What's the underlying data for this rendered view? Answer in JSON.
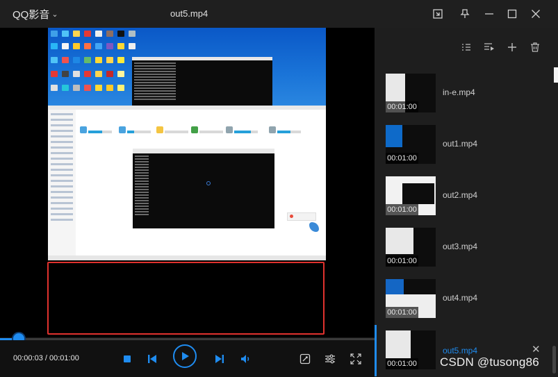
{
  "app": {
    "name": "QQ影音",
    "menu_icon": "chevron-down-icon"
  },
  "window": {
    "title": "out5.mp4",
    "controls": [
      "mini-mode-icon",
      "pin-icon",
      "minimize-icon",
      "maximize-icon",
      "close-icon"
    ]
  },
  "player": {
    "time_current": "00:00:03",
    "time_total": "00:01:00",
    "time_display": "00:00:03 / 00:01:00",
    "progress_fraction": 0.05,
    "controls": [
      "stop-icon",
      "previous-icon",
      "play-icon",
      "next-icon",
      "volume-icon"
    ],
    "right_tools": [
      "screenshot-tool-icon",
      "settings-sliders-icon",
      "fullscreen-icon"
    ]
  },
  "playlist": {
    "tools": [
      "list-view-icon",
      "playlist-mode-icon",
      "add-icon",
      "delete-icon"
    ],
    "items": [
      {
        "name": "in-e.mp4",
        "duration": "00:01:00"
      },
      {
        "name": "out1.mp4",
        "duration": "00:01:00"
      },
      {
        "name": "out2.mp4",
        "duration": "00:01:00"
      },
      {
        "name": "out3.mp4",
        "duration": "00:01:00"
      },
      {
        "name": "out4.mp4",
        "duration": "00:01:00"
      },
      {
        "name": "out5.mp4",
        "duration": "00:01:00",
        "active": true
      }
    ]
  },
  "watermark": "CSDN @tusong86",
  "colors": {
    "accent": "#1f8cf0",
    "highlight_box": "#e0322e",
    "background": "#1a1a1a"
  }
}
